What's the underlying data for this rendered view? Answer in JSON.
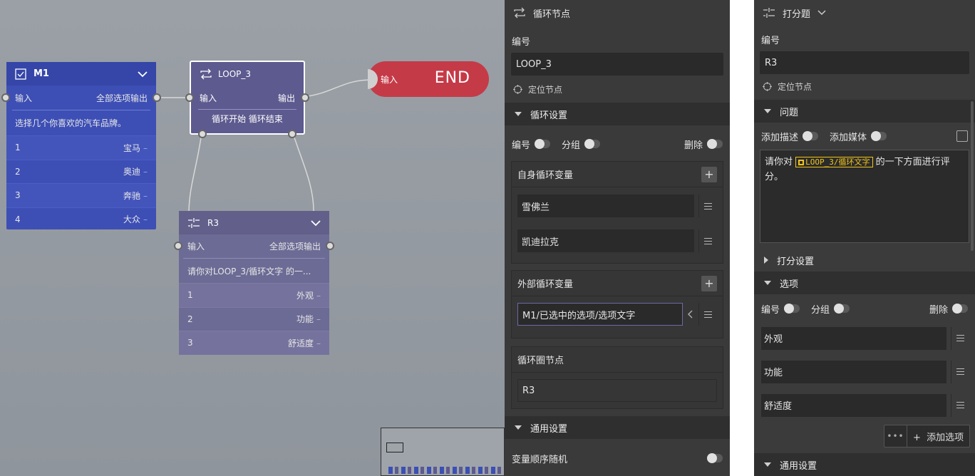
{
  "canvas": {
    "m1": {
      "title": "M1",
      "input": "输入",
      "output": "全部选项输出",
      "desc": "选择几个你喜欢的汽车品牌。",
      "options": [
        {
          "num": "1",
          "label": "宝马"
        },
        {
          "num": "2",
          "label": "奥迪"
        },
        {
          "num": "3",
          "label": "奔驰"
        },
        {
          "num": "4",
          "label": "大众"
        }
      ]
    },
    "loop": {
      "title": "LOOP_3",
      "input": "输入",
      "output": "输出",
      "control": "循环开始 循环结束"
    },
    "end": {
      "label": "END",
      "input": "输入"
    },
    "r3": {
      "title": "R3",
      "input": "输入",
      "output": "全部选项输出",
      "desc": "请你对LOOP_3/循环文字 的一...",
      "options": [
        {
          "num": "1",
          "label": "外观"
        },
        {
          "num": "2",
          "label": "功能"
        },
        {
          "num": "3",
          "label": "舒适度"
        }
      ]
    }
  },
  "loop_panel": {
    "title": "循环节点",
    "id_label": "编号",
    "id_value": "LOOP_3",
    "locate": "定位节点",
    "loop_settings": "循环设置",
    "toggle_number": "编号",
    "toggle_group": "分组",
    "toggle_delete": "删除",
    "own_vars_title": "自身循环变量",
    "own_vars": [
      "雪佛兰",
      "凯迪拉克"
    ],
    "ext_vars_title": "外部循环变量",
    "ext_var": "M1/已选中的选项/选项文字",
    "loop_nodes_title": "循环圈节点",
    "loop_node": "R3",
    "general_settings": "通用设置",
    "random_order": "变量顺序随机"
  },
  "rating_panel": {
    "title": "打分题",
    "id_label": "编号",
    "id_value": "R3",
    "locate": "定位节点",
    "question_section": "问题",
    "add_desc": "添加描述",
    "add_media": "添加媒体",
    "question_prefix": "请你对",
    "question_chip": "LOOP_3/循环文字",
    "question_suffix": "的一下方面进行评分。",
    "score_settings": "打分设置",
    "options_section": "选项",
    "toggle_number": "编号",
    "toggle_group": "分组",
    "toggle_delete": "删除",
    "options": [
      "外观",
      "功能",
      "舒适度"
    ],
    "add_option": "添加选项",
    "general_settings": "通用设置"
  },
  "colors": {
    "m1_node": "#3d4fb5",
    "loop_node": "#5d5a8f",
    "end_node": "#c53a47",
    "r3_node": "#6c6b95",
    "panel_bg": "#3a3a3a",
    "chip": "#f0c419"
  }
}
